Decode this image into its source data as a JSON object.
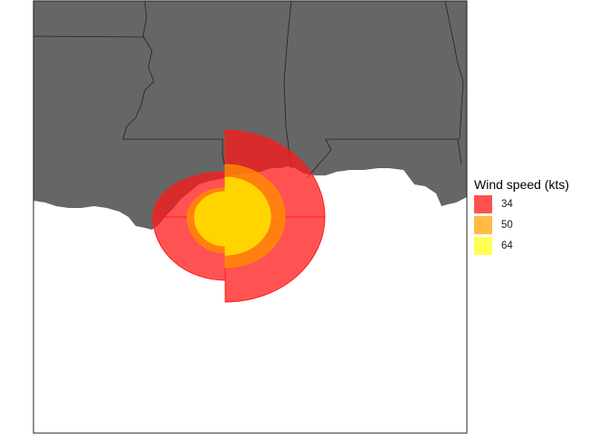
{
  "legend": {
    "title": "Wind speed (kts)",
    "items": [
      {
        "label": "34",
        "color": "#ff5050"
      },
      {
        "label": "50",
        "color": "#ffbb44"
      },
      {
        "label": "64",
        "color": "#ffff55"
      }
    ]
  },
  "colors": {
    "land": "#666666",
    "water": "#ffffff",
    "state_borders": "#222222",
    "wind_34": "#ff1a1a",
    "wind_50": "#ff8c00",
    "wind_64": "#ffee00"
  }
}
